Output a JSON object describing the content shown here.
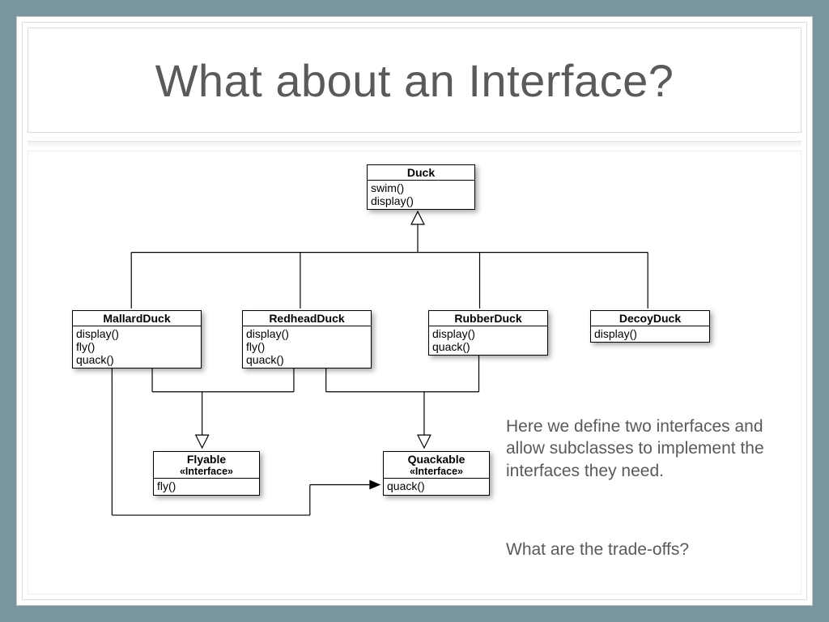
{
  "title": "What about an Interface?",
  "diagram": {
    "duck": {
      "name": "Duck",
      "methods": [
        "swim()",
        "display()"
      ]
    },
    "mallard": {
      "name": "MallardDuck",
      "methods": [
        "display()",
        "fly()",
        "quack()"
      ]
    },
    "redhead": {
      "name": "RedheadDuck",
      "methods": [
        "display()",
        "fly()",
        "quack()"
      ]
    },
    "rubber": {
      "name": "RubberDuck",
      "methods": [
        "display()",
        "quack()"
      ]
    },
    "decoy": {
      "name": "DecoyDuck",
      "methods": [
        "display()"
      ]
    },
    "flyable": {
      "name": "Flyable",
      "stereotype": "«Interface»",
      "methods": [
        "fly()"
      ]
    },
    "quackable": {
      "name": "Quackable",
      "stereotype": "«Interface»",
      "methods": [
        "quack()"
      ]
    }
  },
  "caption1": "Here we define two interfaces and allow subclasses to implement the interfaces they need.",
  "caption2": "What are the trade-offs?"
}
